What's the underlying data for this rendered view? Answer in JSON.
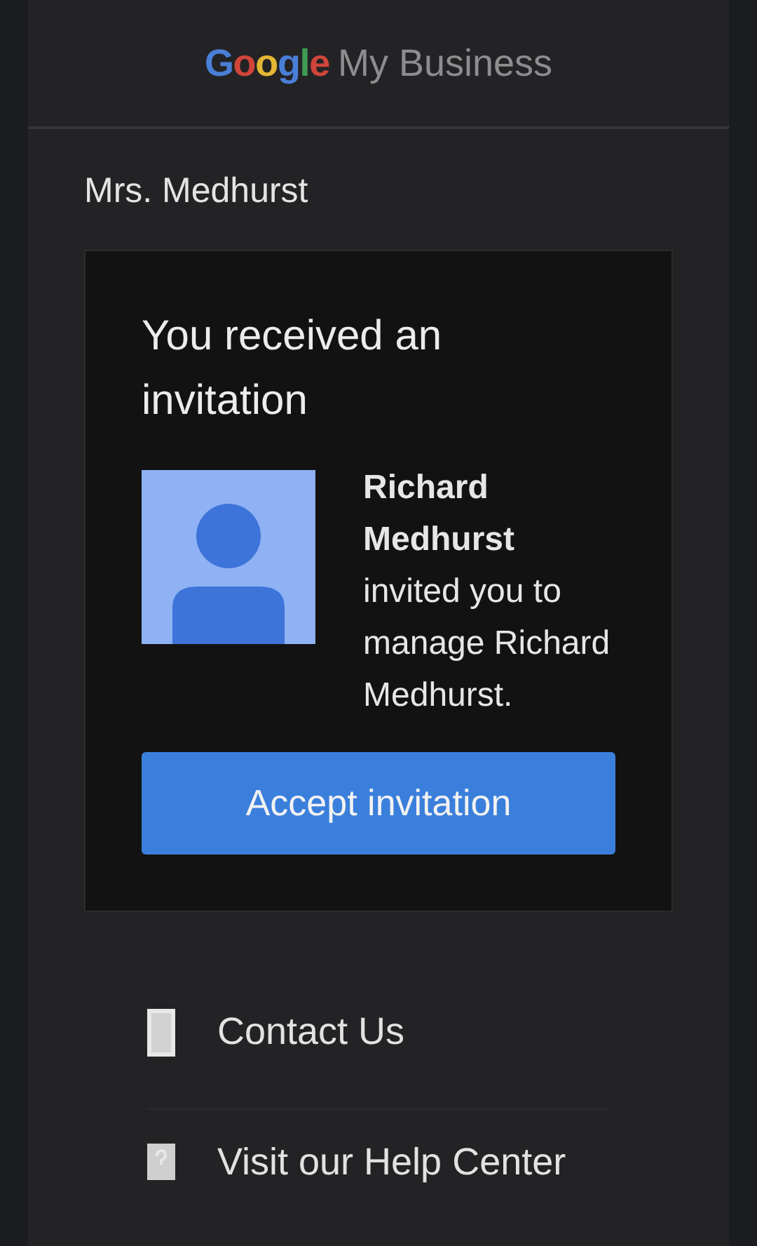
{
  "header": {
    "logo_brand": "Google",
    "logo_product": "My Business"
  },
  "recipient": "Mrs. Medhurst",
  "invitation": {
    "title": "You received an invitation",
    "message": "**Richard Medhurst** invited you to manage Richard Medhurst.",
    "button": "Accept invitation"
  },
  "links": [
    {
      "kind": "contact",
      "label": "Contact Us"
    },
    {
      "kind": "help",
      "label": "Visit our Help Center"
    }
  ]
}
